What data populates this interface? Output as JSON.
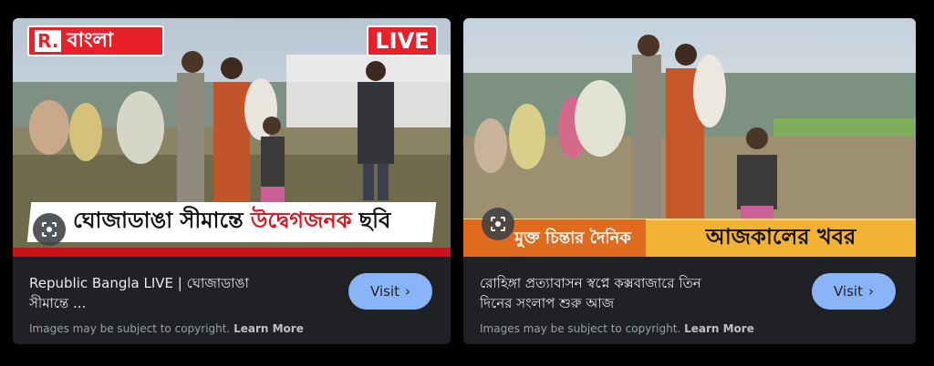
{
  "results": [
    {
      "brand": {
        "prefix": "R.",
        "name": "বাংলা"
      },
      "live_badge": "LIVE",
      "headline": {
        "part1": "ঘোজাডাঙা সীমান্তে",
        "part2": "উদ্বেগজনক",
        "part3": "ছবি"
      },
      "title_line1": "Republic Bangla LIVE | ঘোজাডাঙা",
      "title_line2": "সীমান্তে ...",
      "visit_label": "Visit",
      "copyright_text": "Images may be subject to copyright.",
      "learn_more": "Learn More"
    },
    {
      "ticker_left": "মুক্ত চিন্তার দৈনিক",
      "ticker_right": "আজকালের খবর",
      "title_line1": "রোহিঙ্গা প্রত্যাবাসন স্বপ্নে কক্সবাজারে তিন",
      "title_line2": "দিনের সংলাপ শুরু আজ",
      "visit_label": "Visit",
      "copyright_text": "Images may be subject to copyright.",
      "learn_more": "Learn More"
    }
  ],
  "icons": {
    "lens": "google-lens-icon",
    "chevron": "chevron-right-icon"
  },
  "colors": {
    "card_bg": "#202124",
    "visit_bg": "#8ab4f8",
    "brand_red": "#e8202a"
  }
}
